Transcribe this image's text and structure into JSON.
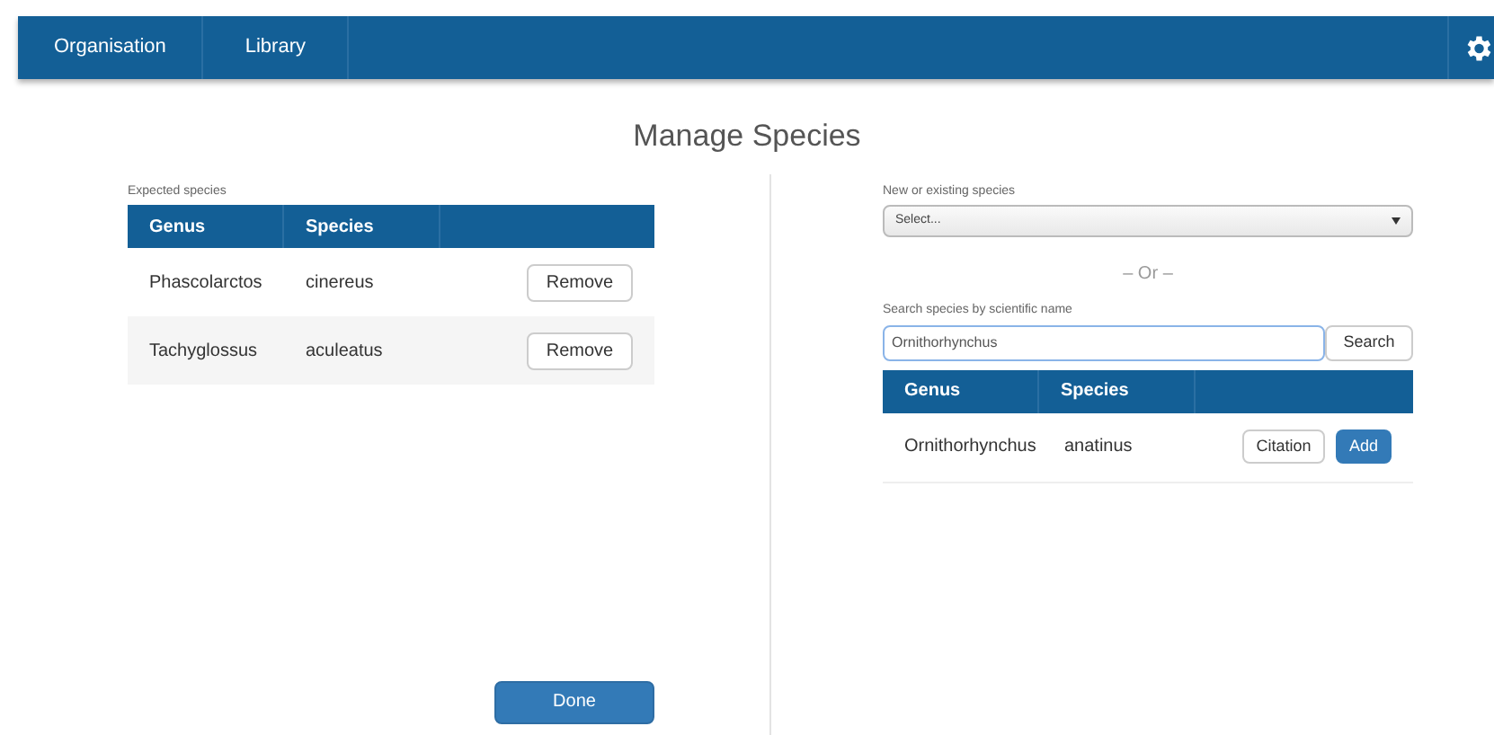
{
  "nav": {
    "items": [
      "Organisation",
      "Library"
    ]
  },
  "title": "Manage Species",
  "expected": {
    "label": "Expected species",
    "columns": [
      "Genus",
      "Species"
    ],
    "rows": [
      {
        "genus": "Phascolarctos",
        "species": "cinereus",
        "action": "Remove"
      },
      {
        "genus": "Tachyglossus",
        "species": "aculeatus",
        "action": "Remove"
      }
    ],
    "done": "Done"
  },
  "add": {
    "select_label": "New or existing species",
    "select_value": "Select...",
    "or": "– Or –",
    "search_label": "Search species by scientific name",
    "search_value": "Ornithorhynchus",
    "search_button": "Search",
    "columns": [
      "Genus",
      "Species"
    ],
    "rows": [
      {
        "genus": "Ornithorhynchus",
        "species": "anatinus",
        "citation": "Citation",
        "add": "Add"
      }
    ]
  }
}
